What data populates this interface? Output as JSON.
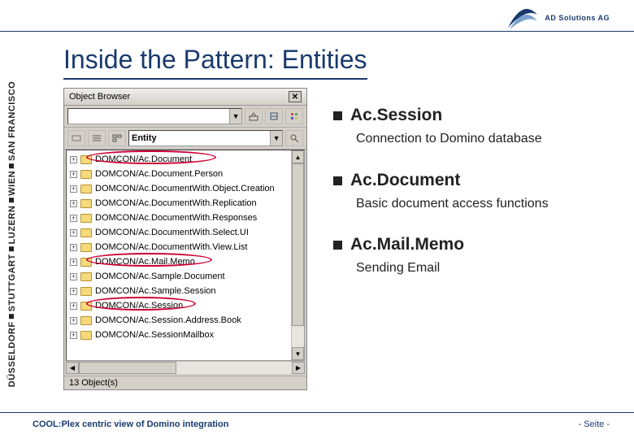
{
  "logo_text": "AD Solutions AG",
  "title": "Inside the Pattern: Entities",
  "sidebar_cities": [
    "DÜSSELDORF",
    "STUTTGART",
    "LUZERN",
    "WIEN",
    "SAN FRANCISCO"
  ],
  "browser": {
    "title": "Object Browser",
    "filter_value": "",
    "entity_label": "Entity",
    "status": "13 Object(s)",
    "items": [
      "DOMCON/Ac.Document",
      "DOMCON/Ac.Document.Person",
      "DOMCON/Ac.DocumentWith.Object.Creation",
      "DOMCON/Ac.DocumentWith.Replication",
      "DOMCON/Ac.DocumentWith.Responses",
      "DOMCON/Ac.DocumentWith.Select.UI",
      "DOMCON/Ac.DocumentWith.View.List",
      "DOMCON/Ac.Mail.Memo",
      "DOMCON/Ac.Sample.Document",
      "DOMCON/Ac.Sample.Session",
      "DOMCON/Ac.Session",
      "DOMCON/Ac.Session.Address.Book",
      "DOMCON/Ac.SessionMailbox"
    ]
  },
  "bullets": [
    {
      "title": "Ac.Session",
      "desc": "Connection to Domino database"
    },
    {
      "title": "Ac.Document",
      "desc": "Basic document access functions"
    },
    {
      "title": "Ac.Mail.Memo",
      "desc": "Sending Email"
    }
  ],
  "footer_left": "COOL:Plex centric view of Domino integration",
  "footer_right": "-  Seite  -"
}
